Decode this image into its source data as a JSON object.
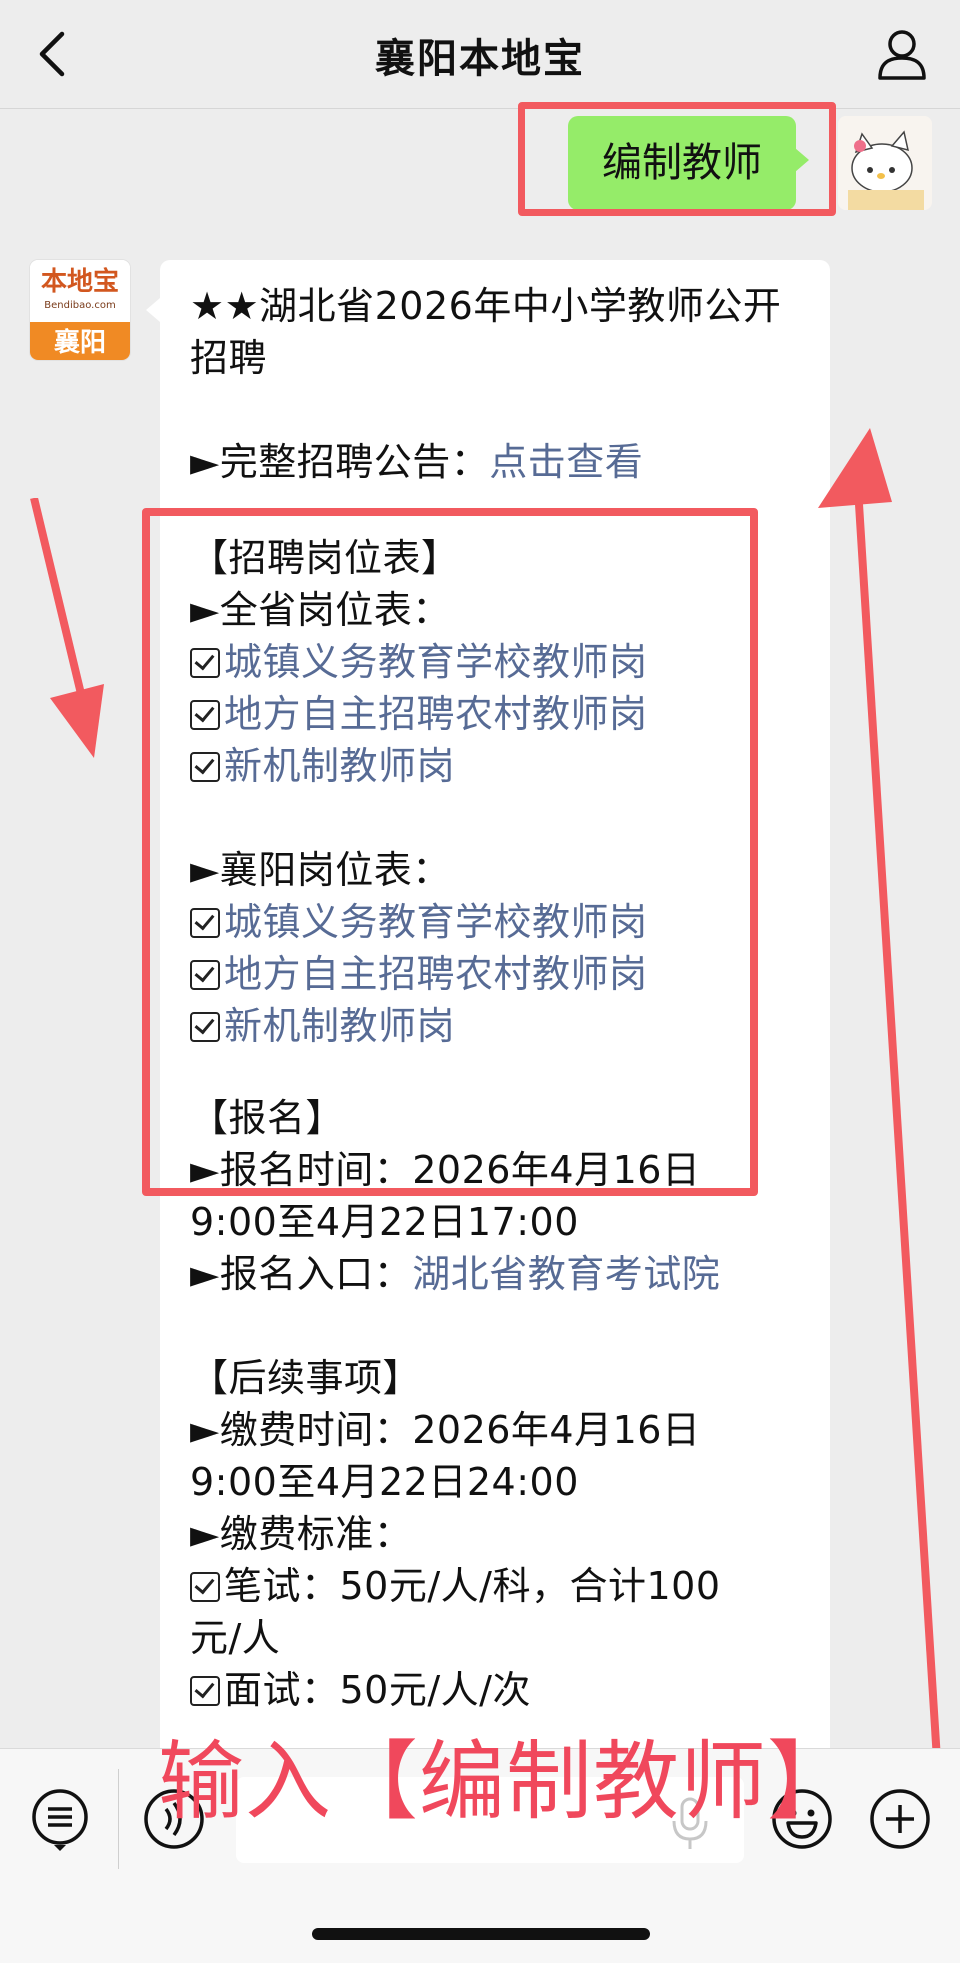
{
  "nav": {
    "title": "襄阳本地宝"
  },
  "sent": {
    "text": "编制教师"
  },
  "bot": {
    "avatar_top": "本地宝",
    "avatar_sub": "Bendibao.com",
    "avatar_city": "襄阳"
  },
  "message": {
    "title": "★★湖北省2026年中小学教师公开招聘",
    "notice_label": "►完整招聘公告：",
    "notice_link": "点击查看",
    "jobs_heading": "【招聘岗位表】",
    "province_label": "►全省岗位表：",
    "province_items": [
      "城镇义务教育学校教师岗",
      "地方自主招聘农村教师岗",
      "新机制教师岗"
    ],
    "xiangyang_label": "►襄阳岗位表：",
    "xiangyang_items": [
      "城镇义务教育学校教师岗",
      "地方自主招聘农村教师岗",
      "新机制教师岗"
    ],
    "signup_heading": "【报名】",
    "signup_time_1": "►报名时间：2026年4月16日",
    "signup_time_2": "9:00至4月22日17:00",
    "signup_entry_label": "►报名入口：",
    "signup_entry_link": "湖北省教育考试院",
    "followup_heading": "【后续事项】",
    "pay_time_1": "►缴费时间：2026年4月16日",
    "pay_time_2": "9:00至4月22日24:00",
    "pay_std_label": "►缴费标准：",
    "pay_written_1": "笔试：50元/人/科，合计100",
    "pay_written_2": "元/人",
    "pay_interview": "面试：50元/人/次"
  },
  "overlay": {
    "caption": "输入【编制教师】"
  },
  "colors": {
    "sent_bubble": "#95ec69",
    "link": "#576b95",
    "highlight": "#f25a5f"
  }
}
